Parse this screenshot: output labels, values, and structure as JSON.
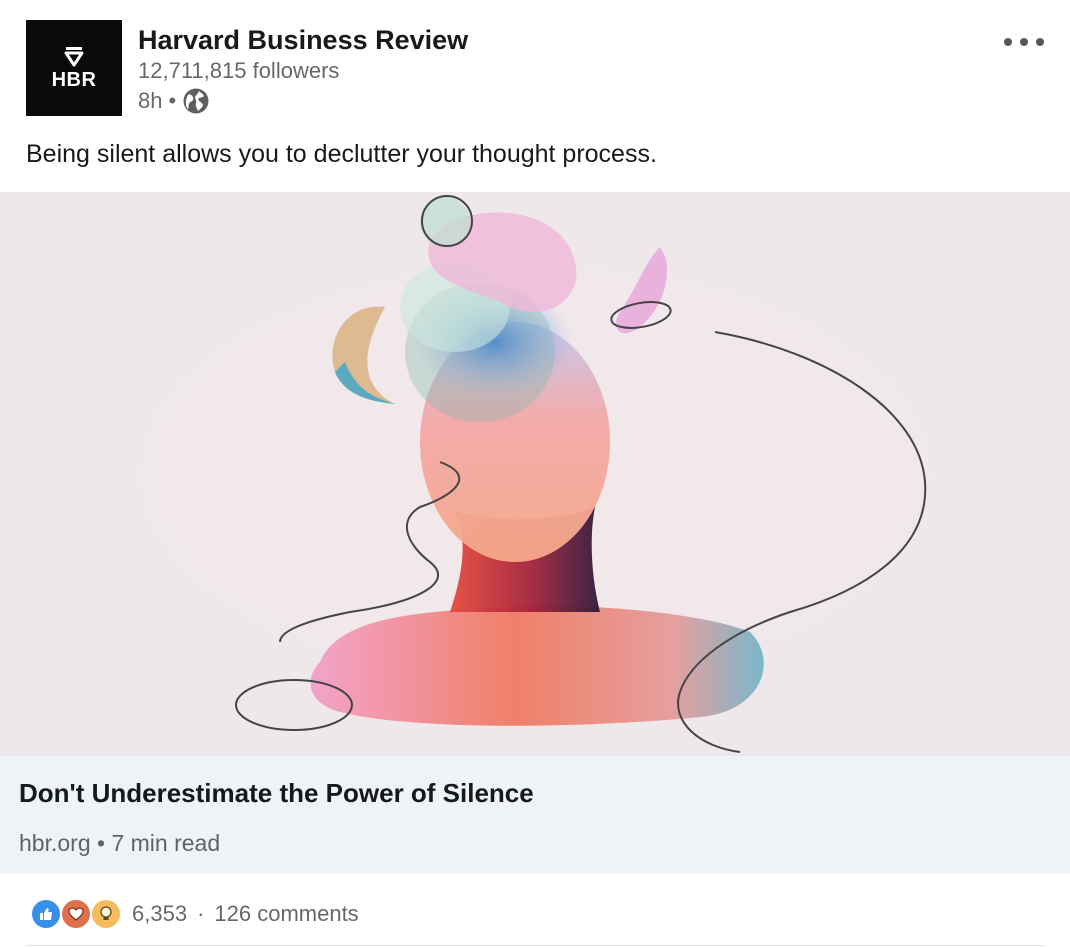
{
  "company": {
    "logo_text": "HBR",
    "name": "Harvard Business Review",
    "followers": "12,711,815 followers",
    "time": "8h",
    "visibility_icon": "globe-icon"
  },
  "post": {
    "text": "Being silent allows you to declutter your thought process."
  },
  "article": {
    "title": "Don't Underestimate the Power of Silence",
    "source": "hbr.org",
    "read_time": "7 min read"
  },
  "social": {
    "reactions": [
      "like-icon",
      "love-icon",
      "insightful-icon"
    ],
    "reaction_count": "6,353",
    "comments": "126 comments"
  },
  "colors": {
    "like": "#378fe9",
    "love": "#df704d",
    "insightful": "#f5bb5c",
    "link_bg": "#eef3f8"
  }
}
